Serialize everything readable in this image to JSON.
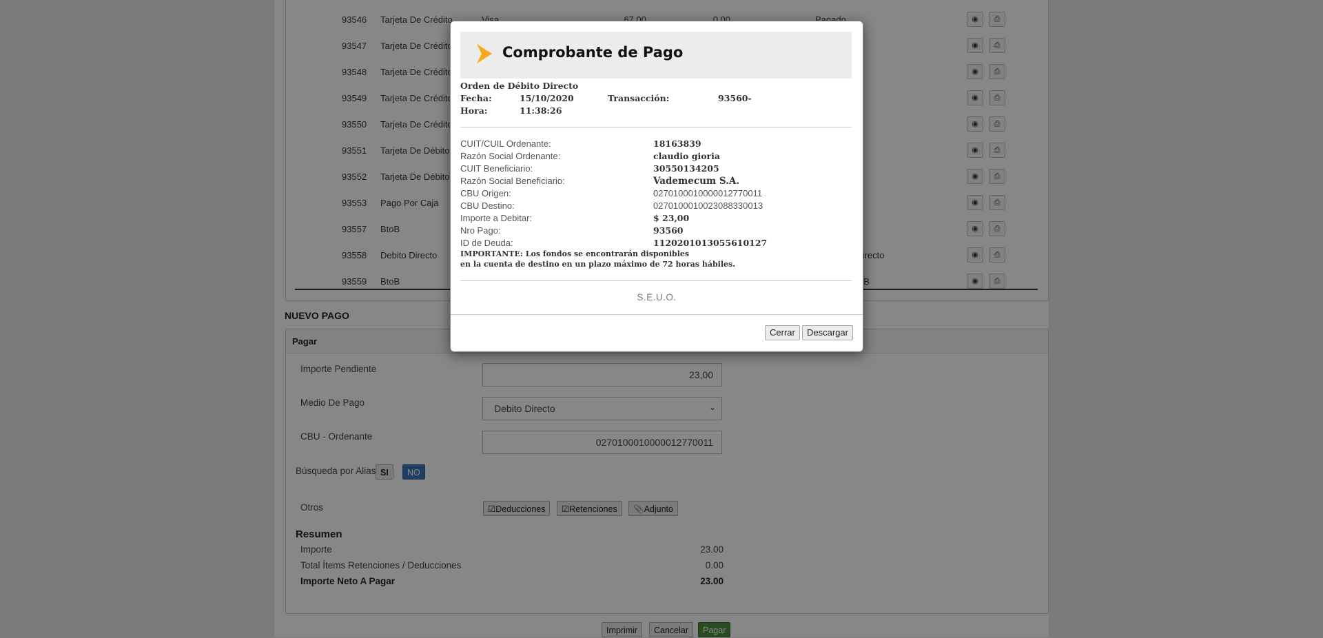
{
  "table": {
    "rows": [
      {
        "id": "93546",
        "tipo": "Tarjeta De Crédito",
        "medio": "Visa",
        "importe": "67,00",
        "retenido": "0,00",
        "estado": "Pagado"
      },
      {
        "id": "93547",
        "tipo": "Tarjeta De Crédito",
        "medio": "",
        "importe": "",
        "retenido": "",
        "estado": ""
      },
      {
        "id": "93548",
        "tipo": "Tarjeta De Crédito",
        "medio": "",
        "importe": "",
        "retenido": "",
        "estado": ""
      },
      {
        "id": "93549",
        "tipo": "Tarjeta De Crédito",
        "medio": "",
        "importe": "",
        "retenido": "",
        "estado": ""
      },
      {
        "id": "93550",
        "tipo": "Tarjeta De Crédito",
        "medio": "",
        "importe": "",
        "retenido": "",
        "estado": ""
      },
      {
        "id": "93551",
        "tipo": "Tarjeta De Débito",
        "medio": "",
        "importe": "",
        "retenido": "",
        "estado": ""
      },
      {
        "id": "93552",
        "tipo": "Tarjeta De Débito",
        "medio": "",
        "importe": "",
        "retenido": "",
        "estado": ""
      },
      {
        "id": "93553",
        "tipo": "Pago Por Caja",
        "medio": "",
        "importe": "",
        "retenido": "",
        "estado": ""
      },
      {
        "id": "93557",
        "tipo": "BtoB",
        "medio": "",
        "importe": "",
        "retenido": "",
        "estado": ""
      },
      {
        "id": "93558",
        "tipo": "Debito Directo",
        "medio": "",
        "importe": "",
        "retenido": "",
        "estado": "de Débito Directo"
      },
      {
        "id": "93559",
        "tipo": "BtoB",
        "medio": "",
        "importe": "",
        "retenido": "",
        "estado": "de pago BtoB"
      }
    ],
    "view_icon": "eye-icon",
    "print_icon": "printer-icon"
  },
  "nuevo_pago": {
    "section_title": "NUEVO PAGO",
    "panel_title": "Pagar",
    "importe_pendiente_label": "Importe Pendiente",
    "importe_pendiente_value": "23,00",
    "medio_label": "Medio De Pago",
    "medio_value": "Debito Directo",
    "cbu_label": "CBU - Ordenante",
    "cbu_value": "0270100010000012770011",
    "alias_label": "Búsqueda por Alias",
    "alias_si": "SI",
    "alias_no": "NO",
    "otros_label": "Otros",
    "deducciones": "Deducciones",
    "retenciones": "Retenciones",
    "adjunto": "Adjunto",
    "resumen_title": "Resumen",
    "resumen": [
      {
        "label": "Importe",
        "value": "23.00"
      },
      {
        "label": "Total Ítems Retenciones / Deducciones",
        "value": "0.00"
      },
      {
        "label": "Importe Neto A Pagar",
        "value": "23.00"
      }
    ],
    "imprimir": "Imprimir",
    "cancelar": "Cancelar",
    "pagar": "Pagar"
  },
  "modal": {
    "title": "Comprobante de Pago",
    "subtitle": "Orden de Débito Directo",
    "fecha_label": "Fecha:",
    "fecha_value": "15/10/2020",
    "hora_label": "Hora:",
    "hora_value": "11:38:26",
    "transaccion_label": "Transacción:",
    "transaccion_value": "93560-",
    "details": [
      {
        "label": "CUIT/CUIL Ordenante:",
        "value": "18163839",
        "bold": true
      },
      {
        "label": "Razón Social Ordenante:",
        "value": "claudio gioria",
        "bold": true
      },
      {
        "label": "CUIT Beneficiario:",
        "value": "30550134205",
        "bold": true
      },
      {
        "label": "Razón Social Beneficiario:",
        "value": "Vademecum S.A.",
        "bold": true
      },
      {
        "label": "CBU Origen:",
        "value": "0270100010000012770011",
        "bold": false
      },
      {
        "label": "CBU Destino:",
        "value": "0270100010023088330013",
        "bold": false
      },
      {
        "label": "Importe a Debitar:",
        "value": "$ 23,00",
        "bold": true
      },
      {
        "label": "Nro Pago:",
        "value": "93560",
        "bold": true
      },
      {
        "label": "ID de Deuda:",
        "value": "1120201013055610127",
        "bold": true
      }
    ],
    "note_line1": "IMPORTANTE: Los fondos se encontrarán disponibles",
    "note_line2": "en la cuenta de destino en un plazo máximo de 72 horas hábiles.",
    "seuo": "S.E.U.O.",
    "cerrar": "Cerrar",
    "descargar": "Descargar",
    "accent_color": "#f7a81b"
  }
}
